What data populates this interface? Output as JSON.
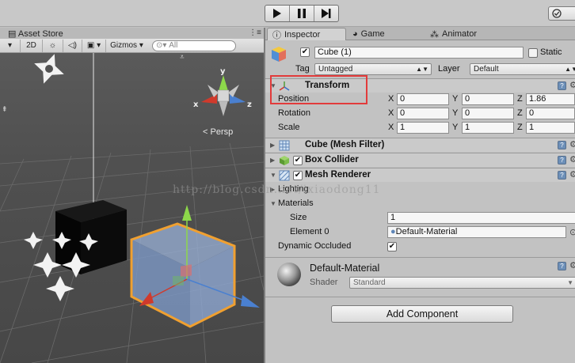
{
  "toolbar": {
    "play_icon": "play-icon",
    "pause_icon": "pause-icon",
    "step_icon": "step-icon",
    "collab_icon": "check-circle-icon"
  },
  "scene": {
    "tab_label": "Asset Store",
    "toolbar": {
      "mode_2d": "2D",
      "light_icon": "sun-icon",
      "audio_icon": "speaker-icon",
      "fx_icon": "image-icon",
      "gizmos_label": "Gizmos",
      "search_placeholder": "All"
    },
    "persp_label": "Persp",
    "gizmo_axes": [
      "y",
      "x",
      "z"
    ]
  },
  "inspector_tabs": [
    {
      "label": "Inspector",
      "icon": "info-icon"
    },
    {
      "label": "Game",
      "icon": "pacman-icon"
    },
    {
      "label": "Animator",
      "icon": "nodes-icon"
    }
  ],
  "object": {
    "name": "Cube (1)",
    "static_label": "Static",
    "tag_label": "Tag",
    "tag_value": "Untagged",
    "layer_label": "Layer",
    "layer_value": "Default"
  },
  "transform": {
    "title": "Transform",
    "rows": [
      {
        "label": "Position",
        "x": "0",
        "y": "0",
        "z": "1.86"
      },
      {
        "label": "Rotation",
        "x": "0",
        "y": "0",
        "z": "0"
      },
      {
        "label": "Scale",
        "x": "1",
        "y": "1",
        "z": "1"
      }
    ],
    "axis_labels": [
      "X",
      "Y",
      "Z"
    ]
  },
  "components": {
    "mesh_filter": "Cube (Mesh Filter)",
    "box_collider": "Box Collider",
    "mesh_renderer": "Mesh Renderer"
  },
  "mesh_renderer": {
    "lighting_label": "Lighting",
    "materials_label": "Materials",
    "size_label": "Size",
    "size_value": "1",
    "element0_label": "Element 0",
    "element0_value": "Default-Material",
    "dynamic_occluded_label": "Dynamic Occluded"
  },
  "material": {
    "name": "Default-Material",
    "shader_label": "Shader",
    "shader_value": "Standard"
  },
  "watermark": "http://blog.csdn.net/ixiaodong11",
  "add_component_label": "Add Component",
  "colors": {
    "highlight_box": "#e23b3b",
    "selection_outline": "#f0a030",
    "x_axis": "#d03a2c",
    "y_axis": "#8dd84a",
    "z_axis": "#4a80d0"
  }
}
